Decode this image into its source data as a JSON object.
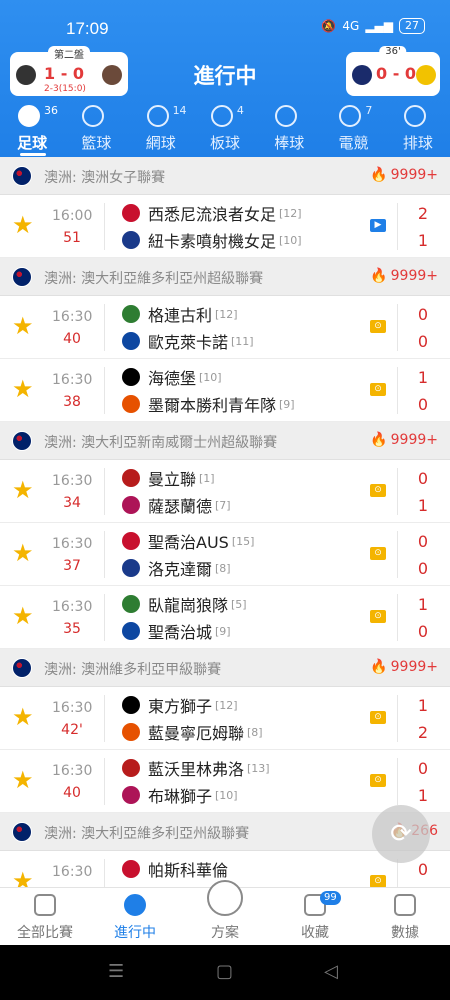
{
  "status": {
    "time": "17:09",
    "battery": "27",
    "net": "4G"
  },
  "header": {
    "title": "進行中",
    "left_card": {
      "tag": "第二盤",
      "score": "1 - 0",
      "sub": "2-3(15:0)"
    },
    "right_card": {
      "tag": "36'",
      "score": "0 - 0"
    }
  },
  "sports": [
    {
      "label": "足球",
      "count": "36",
      "icon": "soccer-ball-icon"
    },
    {
      "label": "籃球",
      "count": "",
      "icon": "basketball-icon"
    },
    {
      "label": "網球",
      "count": "14",
      "icon": "tennis-icon"
    },
    {
      "label": "板球",
      "count": "4",
      "icon": "cricket-icon"
    },
    {
      "label": "棒球",
      "count": "",
      "icon": "baseball-icon"
    },
    {
      "label": "電競",
      "count": "7",
      "icon": "gamepad-icon"
    },
    {
      "label": "排球",
      "count": "",
      "icon": "volleyball-icon"
    }
  ],
  "leagues": [
    {
      "name": "澳洲: 澳洲女子聯賽",
      "heat": "9999+",
      "matches": [
        {
          "time": "16:00",
          "minute": "51",
          "home": "西悉尼流浪者女足",
          "home_rank": "[12]",
          "away": "紐卡素噴射機女足",
          "away_rank": "[10]",
          "hs": "2",
          "as": "1",
          "badge": "video"
        }
      ]
    },
    {
      "name": "澳洲: 澳大利亞維多利亞州超級聯賽",
      "heat": "9999+",
      "matches": [
        {
          "time": "16:30",
          "minute": "40",
          "home": "格連古利",
          "home_rank": "[12]",
          "away": "歐克萊卡諾",
          "away_rank": "[11]",
          "hs": "0",
          "as": "0",
          "badge": "live"
        },
        {
          "time": "16:30",
          "minute": "38",
          "home": "海德堡",
          "home_rank": "[10]",
          "away": "墨爾本勝利青年隊",
          "away_rank": "[9]",
          "hs": "1",
          "as": "0",
          "badge": "live"
        }
      ]
    },
    {
      "name": "澳洲: 澳大利亞新南威爾士州超級聯賽",
      "heat": "9999+",
      "matches": [
        {
          "time": "16:30",
          "minute": "34",
          "home": "曼立聯",
          "home_rank": "[1]",
          "away": "薩瑟蘭德",
          "away_rank": "[7]",
          "hs": "0",
          "as": "1",
          "badge": "live"
        },
        {
          "time": "16:30",
          "minute": "37",
          "home": "聖喬治AUS",
          "home_rank": "[15]",
          "away": "洛克達爾",
          "away_rank": "[8]",
          "hs": "0",
          "as": "0",
          "badge": "live"
        },
        {
          "time": "16:30",
          "minute": "35",
          "home": "臥龍崗狼隊",
          "home_rank": "[5]",
          "away": "聖喬治城",
          "away_rank": "[9]",
          "hs": "1",
          "as": "0",
          "badge": "live"
        }
      ]
    },
    {
      "name": "澳洲: 澳洲維多利亞甲級聯賽",
      "heat": "9999+",
      "matches": [
        {
          "time": "16:30",
          "minute": "42'",
          "home": "東方獅子",
          "home_rank": "[12]",
          "away": "藍曼寧厄姆聯",
          "away_rank": "[8]",
          "hs": "1",
          "as": "2",
          "badge": "live"
        },
        {
          "time": "16:30",
          "minute": "40",
          "home": "藍沃里林弗洛",
          "home_rank": "[13]",
          "away": "布琳獅子",
          "away_rank": "[10]",
          "hs": "0",
          "as": "1",
          "badge": "live"
        }
      ]
    },
    {
      "name": "澳洲: 澳大利亞維多利亞州級聯賽",
      "heat": "266",
      "matches": [
        {
          "time": "16:30",
          "minute": "",
          "home": "帕斯科華倫",
          "home_rank": "",
          "away": "",
          "away_rank": "",
          "hs": "0",
          "as": "",
          "badge": "live"
        }
      ]
    }
  ],
  "bottom_nav": [
    {
      "label": "全部比賽",
      "icon": "trophy-icon",
      "badge": ""
    },
    {
      "label": "進行中",
      "icon": "play-icon",
      "badge": ""
    },
    {
      "label": "方案",
      "icon": "document-icon",
      "badge": ""
    },
    {
      "label": "收藏",
      "icon": "star-outline-icon",
      "badge": "99"
    },
    {
      "label": "數據",
      "icon": "chart-icon",
      "badge": ""
    }
  ],
  "colors": {
    "primary": "#1f7fe7",
    "live_red": "#d62c2c",
    "star": "#f4b400",
    "heat": "#f26a22"
  }
}
